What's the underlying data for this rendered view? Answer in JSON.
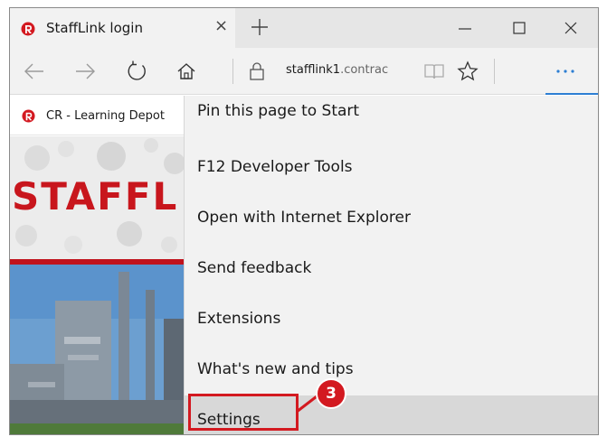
{
  "tab": {
    "title": "StaffLink login",
    "close_glyph": "×"
  },
  "window_controls": {
    "minimize": "minimize-icon",
    "maximize": "maximize-icon",
    "close": "close-icon"
  },
  "address_bar": {
    "url_host": "stafflink1",
    "url_rest": ".contrac"
  },
  "favorites": {
    "item_label": "CR - Learning Depot"
  },
  "page": {
    "brand_text": "STAFFL"
  },
  "menu": {
    "items": [
      {
        "label": "Pin this page to Start"
      },
      {
        "label": "F12 Developer Tools"
      },
      {
        "label": "Open with Internet Explorer"
      },
      {
        "label": "Send feedback"
      },
      {
        "label": "Extensions"
      },
      {
        "label": "What's new and tips"
      },
      {
        "label": "Settings"
      }
    ],
    "highlighted_index": 6
  },
  "annotation": {
    "step_number": "3"
  },
  "colors": {
    "accent_blue": "#2d7fd3",
    "annotation_red": "#d31920",
    "brand_red": "#c8161d"
  }
}
